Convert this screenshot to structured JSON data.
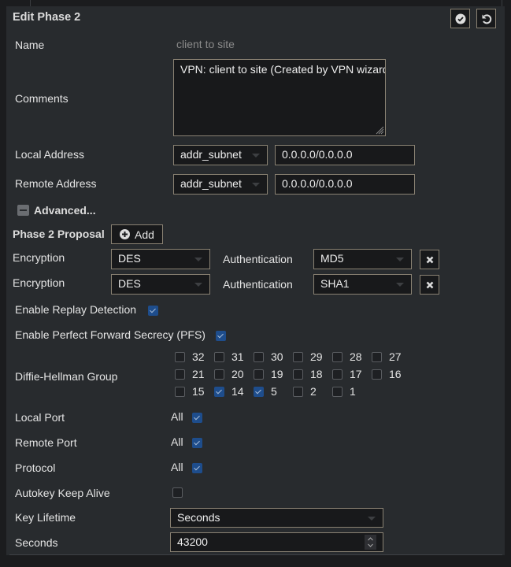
{
  "dialog": {
    "title": "Edit Phase 2",
    "save_icon": "check-circle-icon",
    "revert_icon": "undo-icon"
  },
  "name": {
    "label": "Name",
    "value": "client to site"
  },
  "comments": {
    "label": "Comments",
    "value": "VPN: client to site (Created by VPN wizard)"
  },
  "local_address": {
    "label": "Local Address",
    "type": "addr_subnet",
    "value": "0.0.0.0/0.0.0.0"
  },
  "remote_address": {
    "label": "Remote Address",
    "type": "addr_subnet",
    "value": "0.0.0.0/0.0.0.0"
  },
  "advanced": {
    "label": "Advanced...",
    "icon": "minus-square-icon"
  },
  "proposal": {
    "label": "Phase 2 Proposal",
    "add_label": "Add",
    "rows": [
      {
        "enc_label": "Encryption",
        "enc": "DES",
        "auth_label": "Authentication",
        "auth": "MD5"
      },
      {
        "enc_label": "Encryption",
        "enc": "DES",
        "auth_label": "Authentication",
        "auth": "SHA1"
      }
    ]
  },
  "replay": {
    "label": "Enable Replay Detection",
    "checked": true
  },
  "pfs": {
    "label": "Enable Perfect Forward Secrecy (PFS)",
    "checked": true
  },
  "dh": {
    "label": "Diffie-Hellman Group",
    "groups": [
      [
        {
          "n": "32",
          "c": false
        },
        {
          "n": "31",
          "c": false
        },
        {
          "n": "30",
          "c": false
        },
        {
          "n": "29",
          "c": false
        },
        {
          "n": "28",
          "c": false
        },
        {
          "n": "27",
          "c": false
        }
      ],
      [
        {
          "n": "21",
          "c": false
        },
        {
          "n": "20",
          "c": false
        },
        {
          "n": "19",
          "c": false
        },
        {
          "n": "18",
          "c": false
        },
        {
          "n": "17",
          "c": false
        },
        {
          "n": "16",
          "c": false
        }
      ],
      [
        {
          "n": "15",
          "c": false
        },
        {
          "n": "14",
          "c": true
        },
        {
          "n": "5",
          "c": true
        },
        {
          "n": "2",
          "c": false
        },
        {
          "n": "1",
          "c": false
        }
      ]
    ]
  },
  "local_port": {
    "label": "Local Port",
    "all": "All",
    "checked": true
  },
  "remote_port": {
    "label": "Remote Port",
    "all": "All",
    "checked": true
  },
  "protocol": {
    "label": "Protocol",
    "all": "All",
    "checked": true
  },
  "autokey": {
    "label": "Autokey Keep Alive",
    "checked": false
  },
  "key_lifetime": {
    "label": "Key Lifetime",
    "value": "Seconds"
  },
  "seconds": {
    "label": "Seconds",
    "value": "43200"
  },
  "colors": {
    "accent": "#1e4d8c",
    "panel": "#282b2e",
    "input_bg": "#18191b",
    "border": "#8a8273"
  }
}
